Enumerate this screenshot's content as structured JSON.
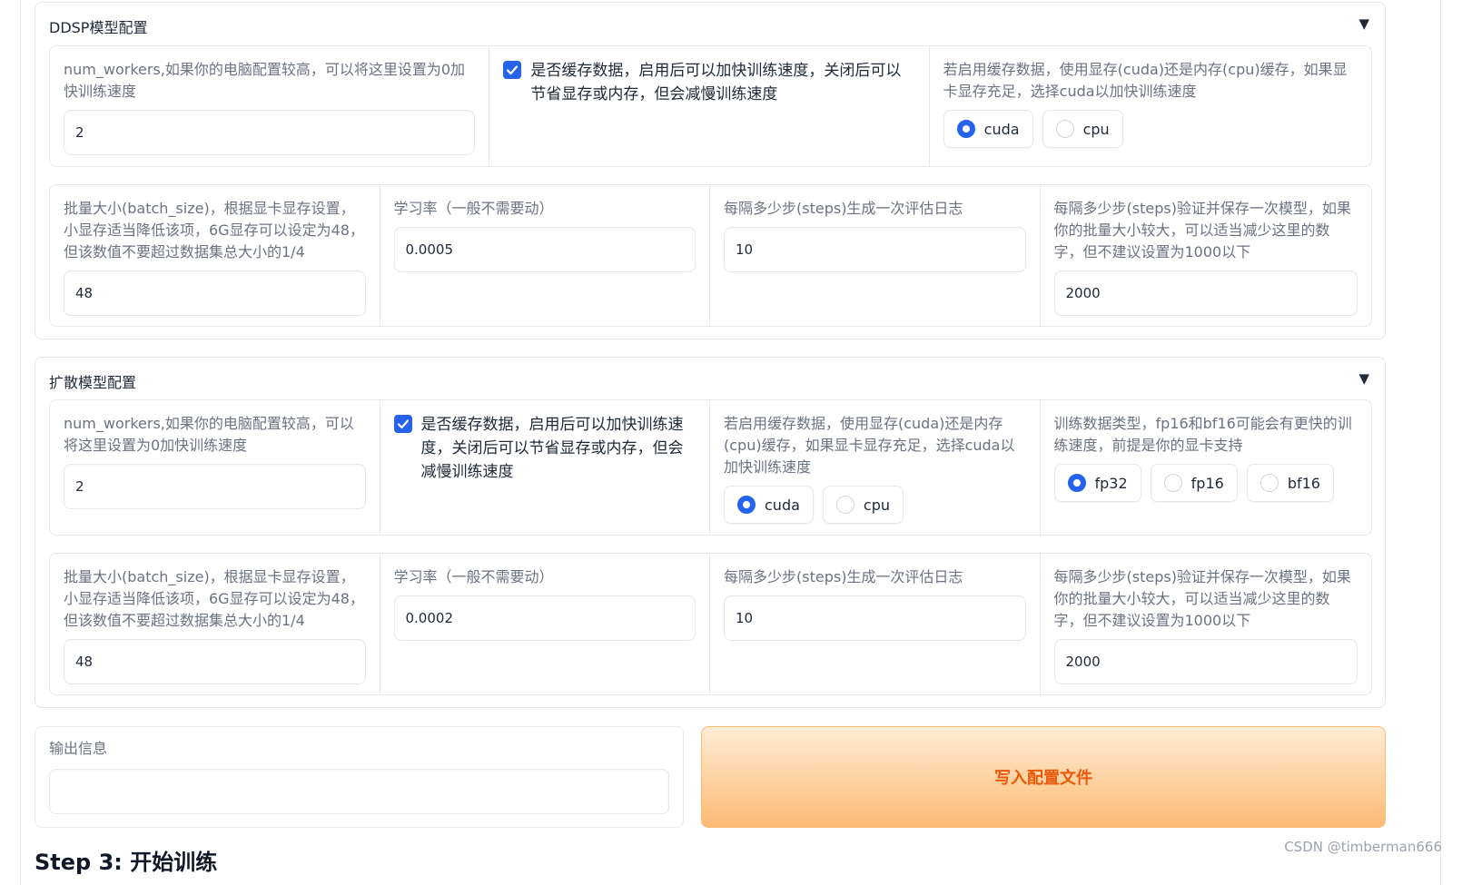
{
  "ddsp": {
    "title": "DDSP模型配置",
    "arrow": "▼",
    "num_workers_label": "num_workers,如果你的电脑配置较高，可以将这里设置为0加快训练速度",
    "num_workers_value": "2",
    "cache_label": "是否缓存数据，启用后可以加快训练速度，关闭后可以节省显存或内存，但会减慢训练速度",
    "device_label": "若启用缓存数据，使用显存(cuda)还是内存(cpu)缓存，如果显卡显存充足，选择cuda以加快训练速度",
    "device_options": [
      "cuda",
      "cpu"
    ],
    "device_selected": "cuda",
    "batch_label": "批量大小(batch_size)，根据显卡显存设置，小显存适当降低该项，6G显存可以设定为48，但该数值不要超过数据集总大小的1/4",
    "batch_value": "48",
    "lr_label": "学习率（一般不需要动）",
    "lr_value": "0.0005",
    "log_label": "每隔多少步(steps)生成一次评估日志",
    "log_value": "10",
    "save_label": "每隔多少步(steps)验证并保存一次模型，如果你的批量大小较大，可以适当减少这里的数字，但不建议设置为1000以下",
    "save_value": "2000"
  },
  "diffusion": {
    "title": "扩散模型配置",
    "arrow": "▼",
    "num_workers_label": "num_workers,如果你的电脑配置较高，可以将这里设置为0加快训练速度",
    "num_workers_value": "2",
    "cache_label": "是否缓存数据，启用后可以加快训练速度，关闭后可以节省显存或内存，但会减慢训练速度",
    "device_label": "若启用缓存数据，使用显存(cuda)还是内存(cpu)缓存，如果显卡显存充足，选择cuda以加快训练速度",
    "device_options": [
      "cuda",
      "cpu"
    ],
    "device_selected": "cuda",
    "dtype_label": "训练数据类型，fp16和bf16可能会有更快的训练速度，前提是你的显卡支持",
    "dtype_options": [
      "fp32",
      "fp16",
      "bf16"
    ],
    "dtype_selected": "fp32",
    "batch_label": "批量大小(batch_size)，根据显卡显存设置，小显存适当降低该项，6G显存可以设定为48，但该数值不要超过数据集总大小的1/4",
    "batch_value": "48",
    "lr_label": "学习率（一般不需要动）",
    "lr_value": "0.0002",
    "log_label": "每隔多少步(steps)生成一次评估日志",
    "log_value": "10",
    "save_label": "每隔多少步(steps)验证并保存一次模型，如果你的批量大小较大，可以适当减少这里的数字，但不建议设置为1000以下",
    "save_value": "2000"
  },
  "output": {
    "label": "输出信息",
    "value": ""
  },
  "write_button": "写入配置文件",
  "step3_title": "Step 3: 开始训练",
  "watermark": "CSDN @timberman666",
  "colors": {
    "accent": "#2563eb",
    "button_text": "#ea580c"
  }
}
